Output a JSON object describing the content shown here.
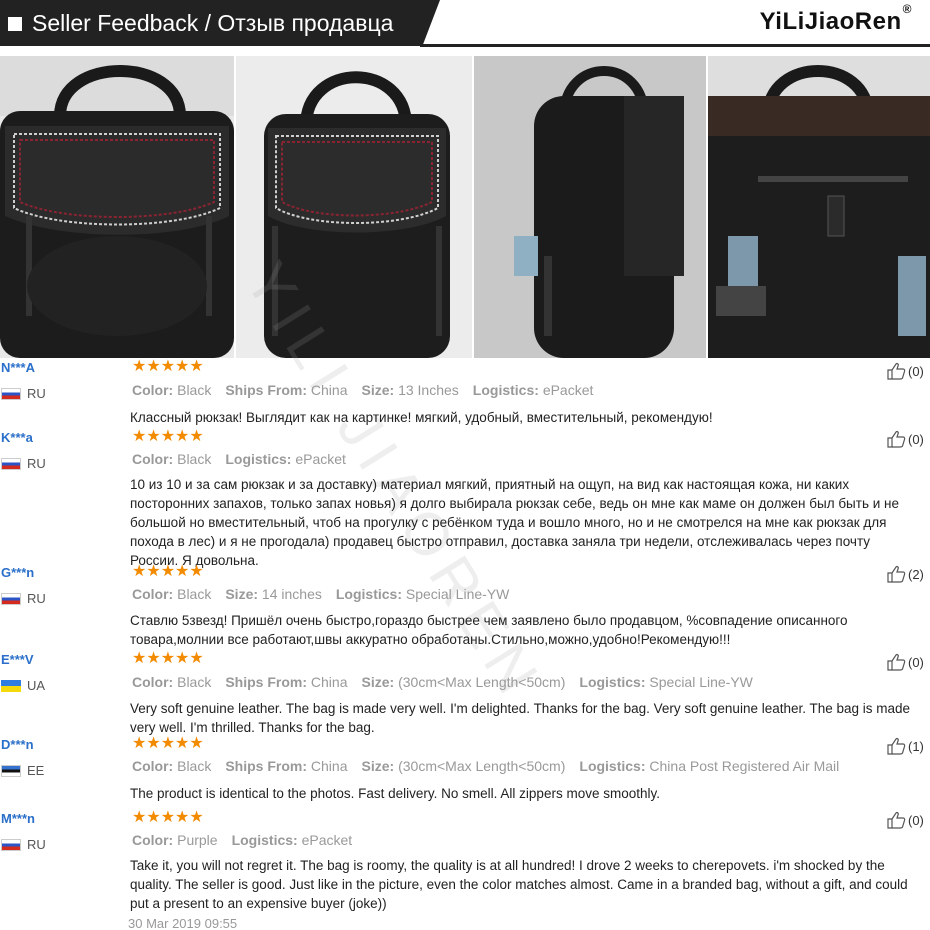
{
  "header": {
    "title": "Seller Feedback / Отзыв продавца",
    "brand": "YiLiJiaoRen",
    "brand_mark": "®"
  },
  "watermark": "YILI JIAOREN",
  "photos": [
    {
      "name": "backpack-front-photo-1"
    },
    {
      "name": "backpack-front-photo-2"
    },
    {
      "name": "backpack-side-photo"
    },
    {
      "name": "backpack-back-photo"
    }
  ],
  "reviews": [
    {
      "user": "N***A",
      "country": "RU",
      "stars": "★★★★★",
      "likes": "(0)",
      "meta": [
        {
          "k": "Color:",
          "v": "Black"
        },
        {
          "k": "Ships From:",
          "v": "China"
        },
        {
          "k": "Size:",
          "v": "13 Inches"
        },
        {
          "k": "Logistics:",
          "v": "ePacket"
        }
      ],
      "text": "Классный рюкзак! Выглядит как на картинке! мягкий, удобный, вместительный, рекомендую!"
    },
    {
      "user": "K***a",
      "country": "RU",
      "stars": "★★★★★",
      "likes": "(0)",
      "meta": [
        {
          "k": "Color:",
          "v": "Black"
        },
        {
          "k": "Logistics:",
          "v": "ePacket"
        }
      ],
      "text": "10 из 10 и за сам рюкзак и за доставку) материал мягкий, приятный на ощуп, на вид как настоящая кожа, ни каких посторонних запахов, только запах новья) я долго выбирала рюкзак себе, ведь он мне как маме он должен был быть и не большой но вместительный, чтоб на прогулку с ребёнком туда и вошло много, но и не смотрелся на мне как рюкзак для похода в лес) и я не прогодала) продавец быстро отправил, доставка заняла три недели, отслеживалась через почту России. Я довольна."
    },
    {
      "user": "G***n",
      "country": "RU",
      "stars": "★★★★★",
      "likes": "(2)",
      "meta": [
        {
          "k": "Color:",
          "v": "Black"
        },
        {
          "k": "Size:",
          "v": "14 inches"
        },
        {
          "k": "Logistics:",
          "v": "Special Line-YW"
        }
      ],
      "text": "Ставлю 5звезд! Пришёл очень быстро,гораздо быстрее чем заявлено было продавцом, %совпадение описанного товара,молнии все работают,швы аккуратно обработаны.Стильно,можно,удобно!Рекомендую!!!"
    },
    {
      "user": "E***V",
      "country": "UA",
      "stars": "★★★★★",
      "likes": "(0)",
      "meta": [
        {
          "k": "Color:",
          "v": "Black"
        },
        {
          "k": "Ships From:",
          "v": "China"
        },
        {
          "k": "Size:",
          "v": "(30cm<Max Length<50cm)"
        },
        {
          "k": "Logistics:",
          "v": "Special Line-YW"
        }
      ],
      "text": "Very soft genuine leather. The bag is made very well. I'm delighted. Thanks for the bag. Very soft genuine leather. The bag is made very well. I'm thrilled. Thanks for the bag."
    },
    {
      "user": "D***n",
      "country": "EE",
      "stars": "★★★★★",
      "likes": "(1)",
      "meta": [
        {
          "k": "Color:",
          "v": "Black"
        },
        {
          "k": "Ships From:",
          "v": "China"
        },
        {
          "k": "Size:",
          "v": "(30cm<Max Length<50cm)"
        },
        {
          "k": "Logistics:",
          "v": "China Post Registered Air Mail"
        }
      ],
      "text": "The product is identical to the photos. Fast delivery. No smell. All zippers move smoothly."
    },
    {
      "user": "M***n",
      "country": "RU",
      "stars": "★★★★★",
      "likes": "(0)",
      "meta": [
        {
          "k": "Color:",
          "v": "Purple"
        },
        {
          "k": "Logistics:",
          "v": "ePacket"
        }
      ],
      "text": "Take it, you will not regret it. The bag is roomy, the quality is at all hundred! I drove 2 weeks to cherepovets. i'm shocked by the quality. The seller is good. Just like in the picture, even the color matches almost. Came in a branded bag, without a gift, and could put a present to an expensive buyer (joke))",
      "date": "30 Mar 2019 09:55"
    }
  ]
}
